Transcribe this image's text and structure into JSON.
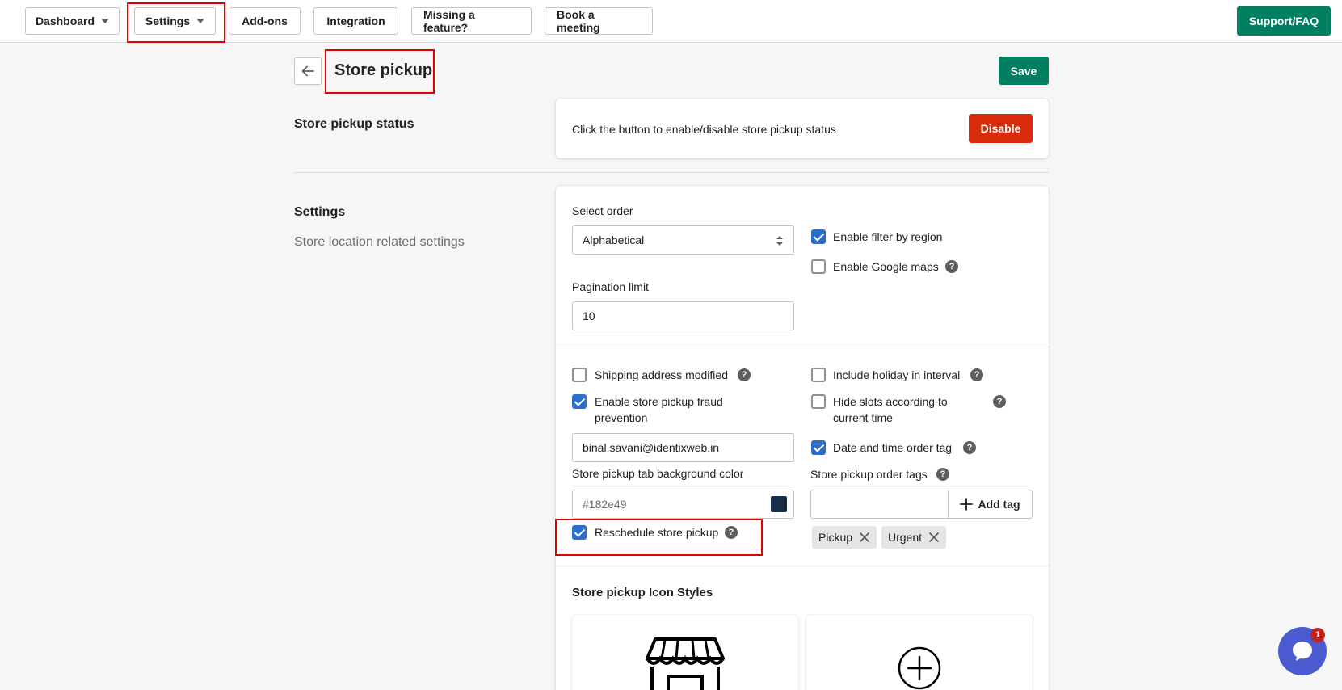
{
  "nav": {
    "dashboard": "Dashboard",
    "settings": "Settings",
    "addons": "Add-ons",
    "integration": "Integration",
    "missing_feature": "Missing a feature?",
    "book_meeting": "Book a meeting",
    "support": "Support/FAQ"
  },
  "header": {
    "title": "Store pickup",
    "save": "Save"
  },
  "status_section": {
    "title": "Store pickup status",
    "description": "Click the button to enable/disable store pickup status",
    "button": "Disable"
  },
  "settings_section": {
    "title": "Settings",
    "subtitle": "Store location related settings",
    "select_order_label": "Select order",
    "select_order_value": "Alphabetical",
    "pagination_label": "Pagination limit",
    "pagination_value": "10",
    "enable_filter_region": {
      "label": "Enable filter by region",
      "checked": true
    },
    "enable_google_maps": {
      "label": "Enable Google maps",
      "checked": false
    },
    "shipping_address_modified": {
      "label": "Shipping address modified",
      "checked": false
    },
    "include_holiday": {
      "label": "Include holiday in interval",
      "checked": false
    },
    "fraud_prevention": {
      "label_line1": "Enable store pickup fraud",
      "label_line2": "prevention",
      "checked": true
    },
    "hide_slots": {
      "label_line1": "Hide slots according to",
      "label_line2": "current time",
      "checked": false
    },
    "fraud_email": "binal.savani@identixweb.in",
    "date_time_tag": {
      "label": "Date and time order tag",
      "checked": true
    },
    "bg_color_label": "Store pickup tab background color",
    "bg_color_value": "#182e49",
    "order_tags_label": "Store pickup order tags",
    "add_tag": "Add tag",
    "tags": [
      "Pickup",
      "Urgent"
    ],
    "reschedule": {
      "label": "Reschedule store pickup",
      "checked": true
    },
    "icon_styles_title": "Store pickup Icon Styles"
  },
  "chat": {
    "badge": "1"
  },
  "colors": {
    "primary": "#008060",
    "critical": "#d82c0d",
    "checkbox": "#2c6ecb",
    "swatch": "#182e49",
    "chat": "#4a5bd1"
  }
}
